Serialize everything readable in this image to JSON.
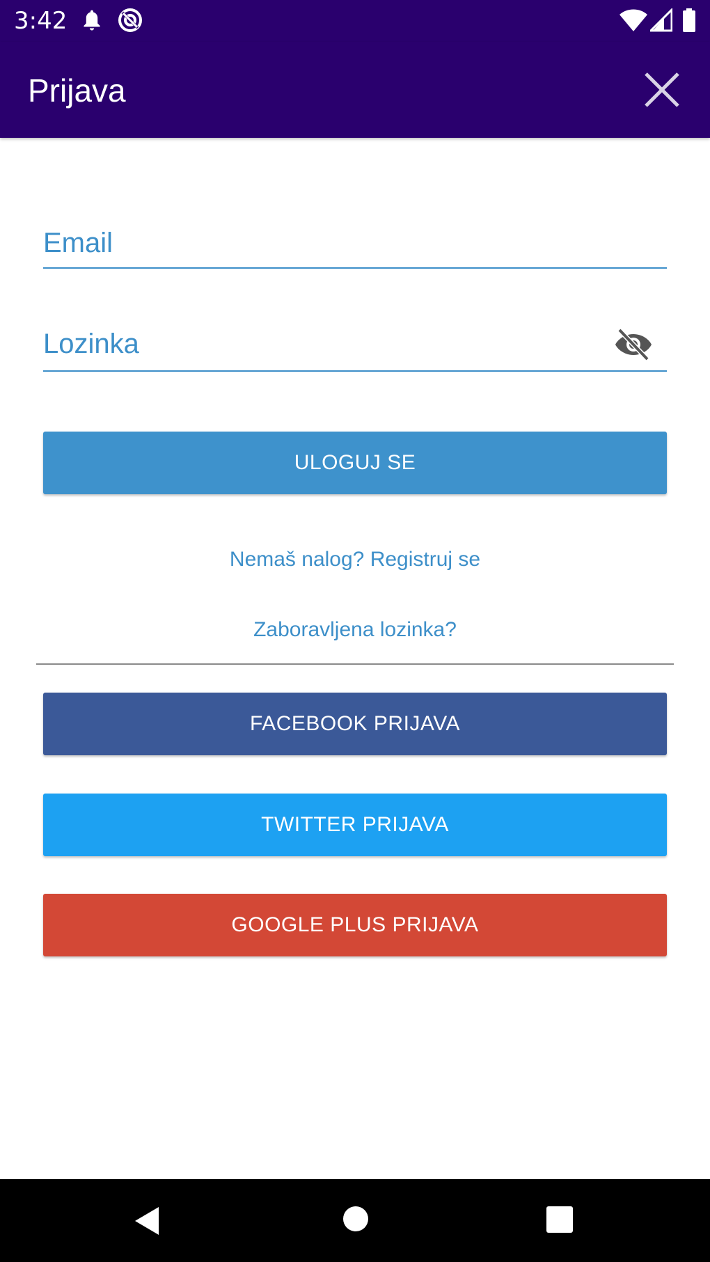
{
  "status_bar": {
    "time": "3:42",
    "icons": [
      "bell-icon",
      "circle-notification-icon",
      "wifi-icon",
      "signal-icon",
      "battery-icon"
    ]
  },
  "app_bar": {
    "title": "Prijava",
    "close_icon": "close-icon"
  },
  "form": {
    "email_placeholder": "Email",
    "email_value": "",
    "password_placeholder": "Lozinka",
    "password_value": "",
    "visibility_icon": "eye-off-icon"
  },
  "actions": {
    "login_label": "ULOGUJ SE",
    "register_link": "Nemaš nalog? Registruj se",
    "forgot_link": "Zaboravljena lozinka?",
    "facebook_label": "FACEBOOK PRIJAVA",
    "twitter_label": "TWITTER PRIJAVA",
    "google_label": "GOOGLE PLUS PRIJAVA"
  },
  "colors": {
    "app_bar": "#2a006e",
    "accent": "#3d8fc9",
    "login_button": "#3e92cc",
    "facebook": "#3b5998",
    "twitter": "#1da1f2",
    "google": "#d34836"
  },
  "nav_bar": {
    "icons": [
      "back-icon",
      "home-icon",
      "recents-icon"
    ]
  }
}
